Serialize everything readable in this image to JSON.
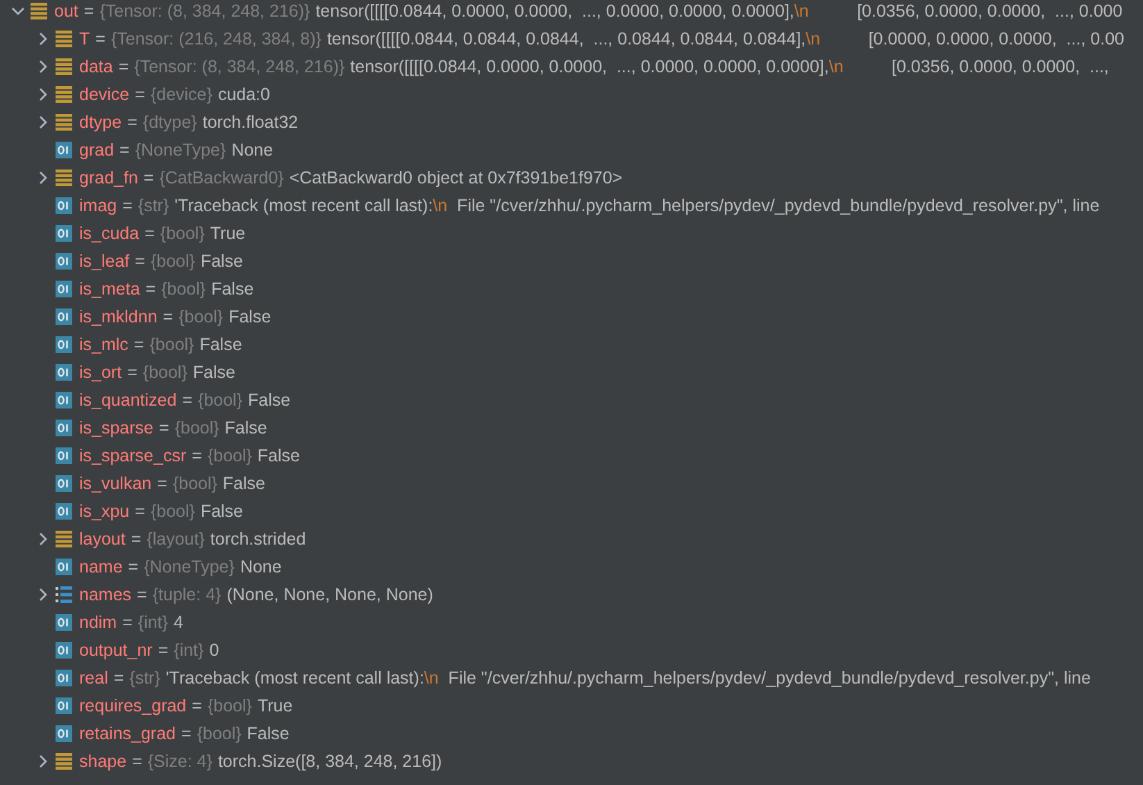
{
  "variables": [
    {
      "name": "out",
      "sep": "=",
      "kind": "object",
      "expanded": true,
      "type": "{Tensor: (8, 384, 248, 216)}",
      "value": [
        {
          "kind": "text",
          "text": "tensor([[[[0.0844, 0.0000, 0.0000,  ..., 0.0000, 0.0000, 0.0000],"
        },
        {
          "kind": "escape",
          "text": "\\n"
        },
        {
          "kind": "text",
          "text": "          [0.0356, 0.0000, 0.0000,  ..., 0.000"
        }
      ],
      "children": [
        {
          "name": "T",
          "sep": "=",
          "kind": "object",
          "expanded": false,
          "type": "{Tensor: (216, 248, 384, 8)}",
          "value": [
            {
              "kind": "text",
              "text": "tensor([[[[0.0844, 0.0844, 0.0844,  ..., 0.0844, 0.0844, 0.0844],"
            },
            {
              "kind": "escape",
              "text": "\\n"
            },
            {
              "kind": "text",
              "text": "          [0.0000, 0.0000, 0.0000,  ..., 0.00"
            }
          ]
        },
        {
          "name": "data",
          "sep": "=",
          "kind": "object",
          "expanded": false,
          "type": "{Tensor: (8, 384, 248, 216)}",
          "value": [
            {
              "kind": "text",
              "text": "tensor([[[[0.0844, 0.0000, 0.0000,  ..., 0.0000, 0.0000, 0.0000],"
            },
            {
              "kind": "escape",
              "text": "\\n"
            },
            {
              "kind": "text",
              "text": "          [0.0356, 0.0000, 0.0000,  ...,"
            }
          ]
        },
        {
          "name": "device",
          "sep": "=",
          "kind": "object",
          "expanded": false,
          "type": "{device}",
          "value": [
            {
              "kind": "text",
              "text": "cuda:0"
            }
          ]
        },
        {
          "name": "dtype",
          "sep": "=",
          "kind": "object",
          "expanded": false,
          "type": "{dtype}",
          "value": [
            {
              "kind": "text",
              "text": "torch.float32"
            }
          ]
        },
        {
          "name": "grad",
          "sep": "=",
          "kind": "primitive",
          "type": "{NoneType}",
          "value": [
            {
              "kind": "text",
              "text": "None"
            }
          ]
        },
        {
          "name": "grad_fn",
          "sep": "=",
          "kind": "object",
          "expanded": false,
          "type": "{CatBackward0}",
          "value": [
            {
              "kind": "text",
              "text": "<CatBackward0 object at 0x7f391be1f970>"
            }
          ]
        },
        {
          "name": "imag",
          "sep": "=",
          "kind": "primitive",
          "type": "{str}",
          "value": [
            {
              "kind": "text",
              "text": "'Traceback (most recent call last):"
            },
            {
              "kind": "escape",
              "text": "\\n"
            },
            {
              "kind": "text",
              "text": "  File \"/cver/zhhu/.pycharm_helpers/pydev/_pydevd_bundle/pydevd_resolver.py\", line"
            }
          ]
        },
        {
          "name": "is_cuda",
          "sep": "=",
          "kind": "primitive",
          "type": "{bool}",
          "value": [
            {
              "kind": "text",
              "text": "True"
            }
          ]
        },
        {
          "name": "is_leaf",
          "sep": "=",
          "kind": "primitive",
          "type": "{bool}",
          "value": [
            {
              "kind": "text",
              "text": "False"
            }
          ]
        },
        {
          "name": "is_meta",
          "sep": "=",
          "kind": "primitive",
          "type": "{bool}",
          "value": [
            {
              "kind": "text",
              "text": "False"
            }
          ]
        },
        {
          "name": "is_mkldnn",
          "sep": "=",
          "kind": "primitive",
          "type": "{bool}",
          "value": [
            {
              "kind": "text",
              "text": "False"
            }
          ]
        },
        {
          "name": "is_mlc",
          "sep": "=",
          "kind": "primitive",
          "type": "{bool}",
          "value": [
            {
              "kind": "text",
              "text": "False"
            }
          ]
        },
        {
          "name": "is_ort",
          "sep": "=",
          "kind": "primitive",
          "type": "{bool}",
          "value": [
            {
              "kind": "text",
              "text": "False"
            }
          ]
        },
        {
          "name": "is_quantized",
          "sep": "=",
          "kind": "primitive",
          "type": "{bool}",
          "value": [
            {
              "kind": "text",
              "text": "False"
            }
          ]
        },
        {
          "name": "is_sparse",
          "sep": "=",
          "kind": "primitive",
          "type": "{bool}",
          "value": [
            {
              "kind": "text",
              "text": "False"
            }
          ]
        },
        {
          "name": "is_sparse_csr",
          "sep": "=",
          "kind": "primitive",
          "type": "{bool}",
          "value": [
            {
              "kind": "text",
              "text": "False"
            }
          ]
        },
        {
          "name": "is_vulkan",
          "sep": "=",
          "kind": "primitive",
          "type": "{bool}",
          "value": [
            {
              "kind": "text",
              "text": "False"
            }
          ]
        },
        {
          "name": "is_xpu",
          "sep": "=",
          "kind": "primitive",
          "type": "{bool}",
          "value": [
            {
              "kind": "text",
              "text": "False"
            }
          ]
        },
        {
          "name": "layout",
          "sep": "=",
          "kind": "object",
          "expanded": false,
          "type": "{layout}",
          "value": [
            {
              "kind": "text",
              "text": "torch.strided"
            }
          ]
        },
        {
          "name": "name",
          "sep": "=",
          "kind": "primitive",
          "type": "{NoneType}",
          "value": [
            {
              "kind": "text",
              "text": "None"
            }
          ]
        },
        {
          "name": "names",
          "sep": "=",
          "kind": "list",
          "expanded": false,
          "type": "{tuple: 4}",
          "value": [
            {
              "kind": "text",
              "text": "(None, None, None, None)"
            }
          ]
        },
        {
          "name": "ndim",
          "sep": "=",
          "kind": "primitive",
          "type": "{int}",
          "value": [
            {
              "kind": "text",
              "text": "4"
            }
          ]
        },
        {
          "name": "output_nr",
          "sep": "=",
          "kind": "primitive",
          "type": "{int}",
          "value": [
            {
              "kind": "text",
              "text": "0"
            }
          ]
        },
        {
          "name": "real",
          "sep": "=",
          "kind": "primitive",
          "type": "{str}",
          "value": [
            {
              "kind": "text",
              "text": "'Traceback (most recent call last):"
            },
            {
              "kind": "escape",
              "text": "\\n"
            },
            {
              "kind": "text",
              "text": "  File \"/cver/zhhu/.pycharm_helpers/pydev/_pydevd_bundle/pydevd_resolver.py\", line"
            }
          ]
        },
        {
          "name": "requires_grad",
          "sep": "=",
          "kind": "primitive",
          "type": "{bool}",
          "value": [
            {
              "kind": "text",
              "text": "True"
            }
          ]
        },
        {
          "name": "retains_grad",
          "sep": "=",
          "kind": "primitive",
          "type": "{bool}",
          "value": [
            {
              "kind": "text",
              "text": "False"
            }
          ]
        },
        {
          "name": "shape",
          "sep": "=",
          "kind": "object",
          "expanded": false,
          "type": "{Size: 4}",
          "value": [
            {
              "kind": "text",
              "text": "torch.Size([8, 384, 248, 216])"
            }
          ]
        }
      ]
    }
  ]
}
